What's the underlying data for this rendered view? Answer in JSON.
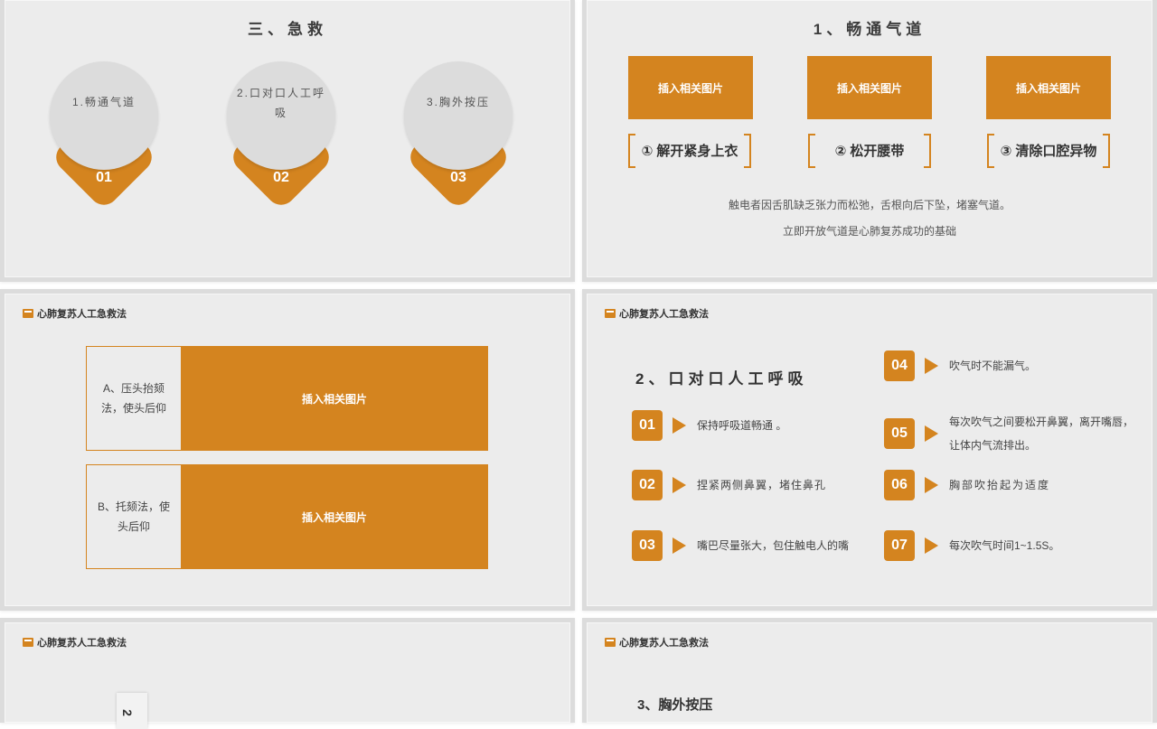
{
  "slide1": {
    "title": "三、急救",
    "badges": [
      {
        "text": "1.畅通气道",
        "num": "01"
      },
      {
        "text": "2.口对口人工呼吸",
        "num": "02"
      },
      {
        "text": "3.胸外按压",
        "num": "03"
      }
    ]
  },
  "slide2": {
    "title": "1、畅通气道",
    "image_placeholder": "插入相关图片",
    "steps": [
      "① 解开紧身上衣",
      "② 松开腰带",
      "③ 清除口腔异物"
    ],
    "line1": "触电者因舌肌缺乏张力而松弛，舌根向后下坠，堵塞气道。",
    "line2": "立即开放气道是心肺复苏成功的基础"
  },
  "header": {
    "brand": "心肺复苏人工急救法"
  },
  "slide3": {
    "rows": [
      {
        "label": "A、压头抬颏法，使头后仰",
        "image": "插入相关图片"
      },
      {
        "label": "B、托颏法，使头后仰",
        "image": "插入相关图片"
      }
    ]
  },
  "slide4": {
    "title": "2、口对口人工呼吸",
    "steps": [
      {
        "num": "01",
        "text": "保持呼吸道畅通 。"
      },
      {
        "num": "02",
        "text": "捏紧两侧鼻翼，堵住鼻孔"
      },
      {
        "num": "03",
        "text": "嘴巴尽量张大，包住触电人的嘴"
      },
      {
        "num": "04",
        "text": "吹气时不能漏气。"
      },
      {
        "num": "05",
        "text": "每次吹气之间要松开鼻翼，离开嘴唇，让体内气流排出。"
      },
      {
        "num": "06",
        "text": "胸部吹抬起为适度"
      },
      {
        "num": "07",
        "text": "每次吹气时间1~1.5S。"
      }
    ]
  },
  "slide5": {
    "tab_text": "2"
  },
  "slide6": {
    "title": "3、胸外按压"
  },
  "colors": {
    "accent": "#d4841f",
    "background": "#ececec"
  }
}
